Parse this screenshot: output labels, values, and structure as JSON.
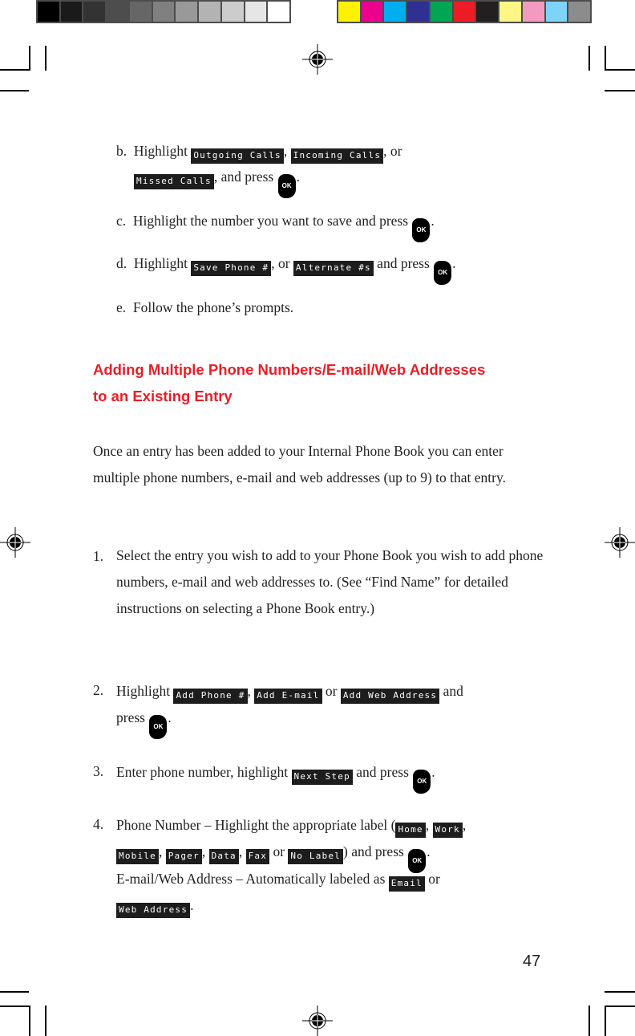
{
  "color_bars": {
    "grayscale": [
      "#000000",
      "#1a1a1a",
      "#333333",
      "#4d4d4d",
      "#666666",
      "#808080",
      "#999999",
      "#b3b3b3",
      "#cccccc",
      "#e6e6e6",
      "#ffffff"
    ],
    "process": [
      "#fff200",
      "#ec008c",
      "#00aeef",
      "#2e3192",
      "#00a651",
      "#ed1c24",
      "#231f20",
      "#fff685",
      "#f49ac1",
      "#7dd4f7",
      "#8c8c8c"
    ]
  },
  "colors": {
    "heading": "#ed1c24",
    "text": "#231f20",
    "lcd_bg": "#111111"
  },
  "ok_key_label": "OK",
  "sub_steps": [
    {
      "marker": "b.",
      "t1": "Highlight ",
      "lcd1": "Outgoing Calls",
      "t2": ", ",
      "lcd2": "Incoming Calls",
      "t3": ", or",
      "lcd3": "Missed Calls",
      "t4": ", and press ",
      "t5": "."
    },
    {
      "marker": "c.",
      "t1": "Highlight the number you want to save and press ",
      "t2": "."
    },
    {
      "marker": "d.",
      "t1": "Highlight ",
      "lcd1": "Save Phone #",
      "t2": ", or ",
      "lcd2": "Alternate #s",
      "t3": " and press ",
      "t4": "."
    },
    {
      "marker": "e.",
      "t1": "Follow the phone’s prompts."
    }
  ],
  "section": {
    "heading_line1": "Adding Multiple Phone Numbers/E-mail/Web Addresses",
    "heading_line2": "to an Existing Entry",
    "intro": "Once an entry has been added to your Internal Phone Book you can enter multiple phone numbers, e-mail and web addresses (up to 9) to that entry."
  },
  "steps": [
    {
      "marker": "1.",
      "text": "Select the entry you wish to add to your Phone Book you wish to add phone numbers, e-mail and web addresses to. (See “Find Name” for detailed instructions on selecting a Phone Book entry.)"
    },
    {
      "marker": "2.",
      "t1": "Highlight ",
      "lcd1": "Add Phone #",
      "t2": ", ",
      "lcd2": "Add E-mail",
      "t3": " or ",
      "lcd3": "Add Web Address",
      "t4": " and",
      "t5": "press ",
      "t6": "."
    },
    {
      "marker": "3.",
      "t1": "Enter phone number, highlight ",
      "lcd1": "Next Step",
      "t2": " and press ",
      "t3": "."
    },
    {
      "marker": "4.",
      "t1": "Phone Number – Highlight the appropriate label (",
      "lcd1": "Home",
      "t2": ", ",
      "lcd2": "Work",
      "t3": ",",
      "lcd3": "Mobile",
      "t4": ", ",
      "lcd4": "Pager",
      "t5": ", ",
      "lcd5": "Data",
      "t6": ", ",
      "lcd6": "Fax",
      "t7": " or ",
      "lcd7": "No Label",
      "t8": ") and press ",
      "t9": ".",
      "t10": "E-mail/Web Address – Automatically labeled as ",
      "lcd8": "Email",
      "t11": " or",
      "lcd9": "Web Address",
      "t12": "."
    }
  ],
  "page_number": "47"
}
